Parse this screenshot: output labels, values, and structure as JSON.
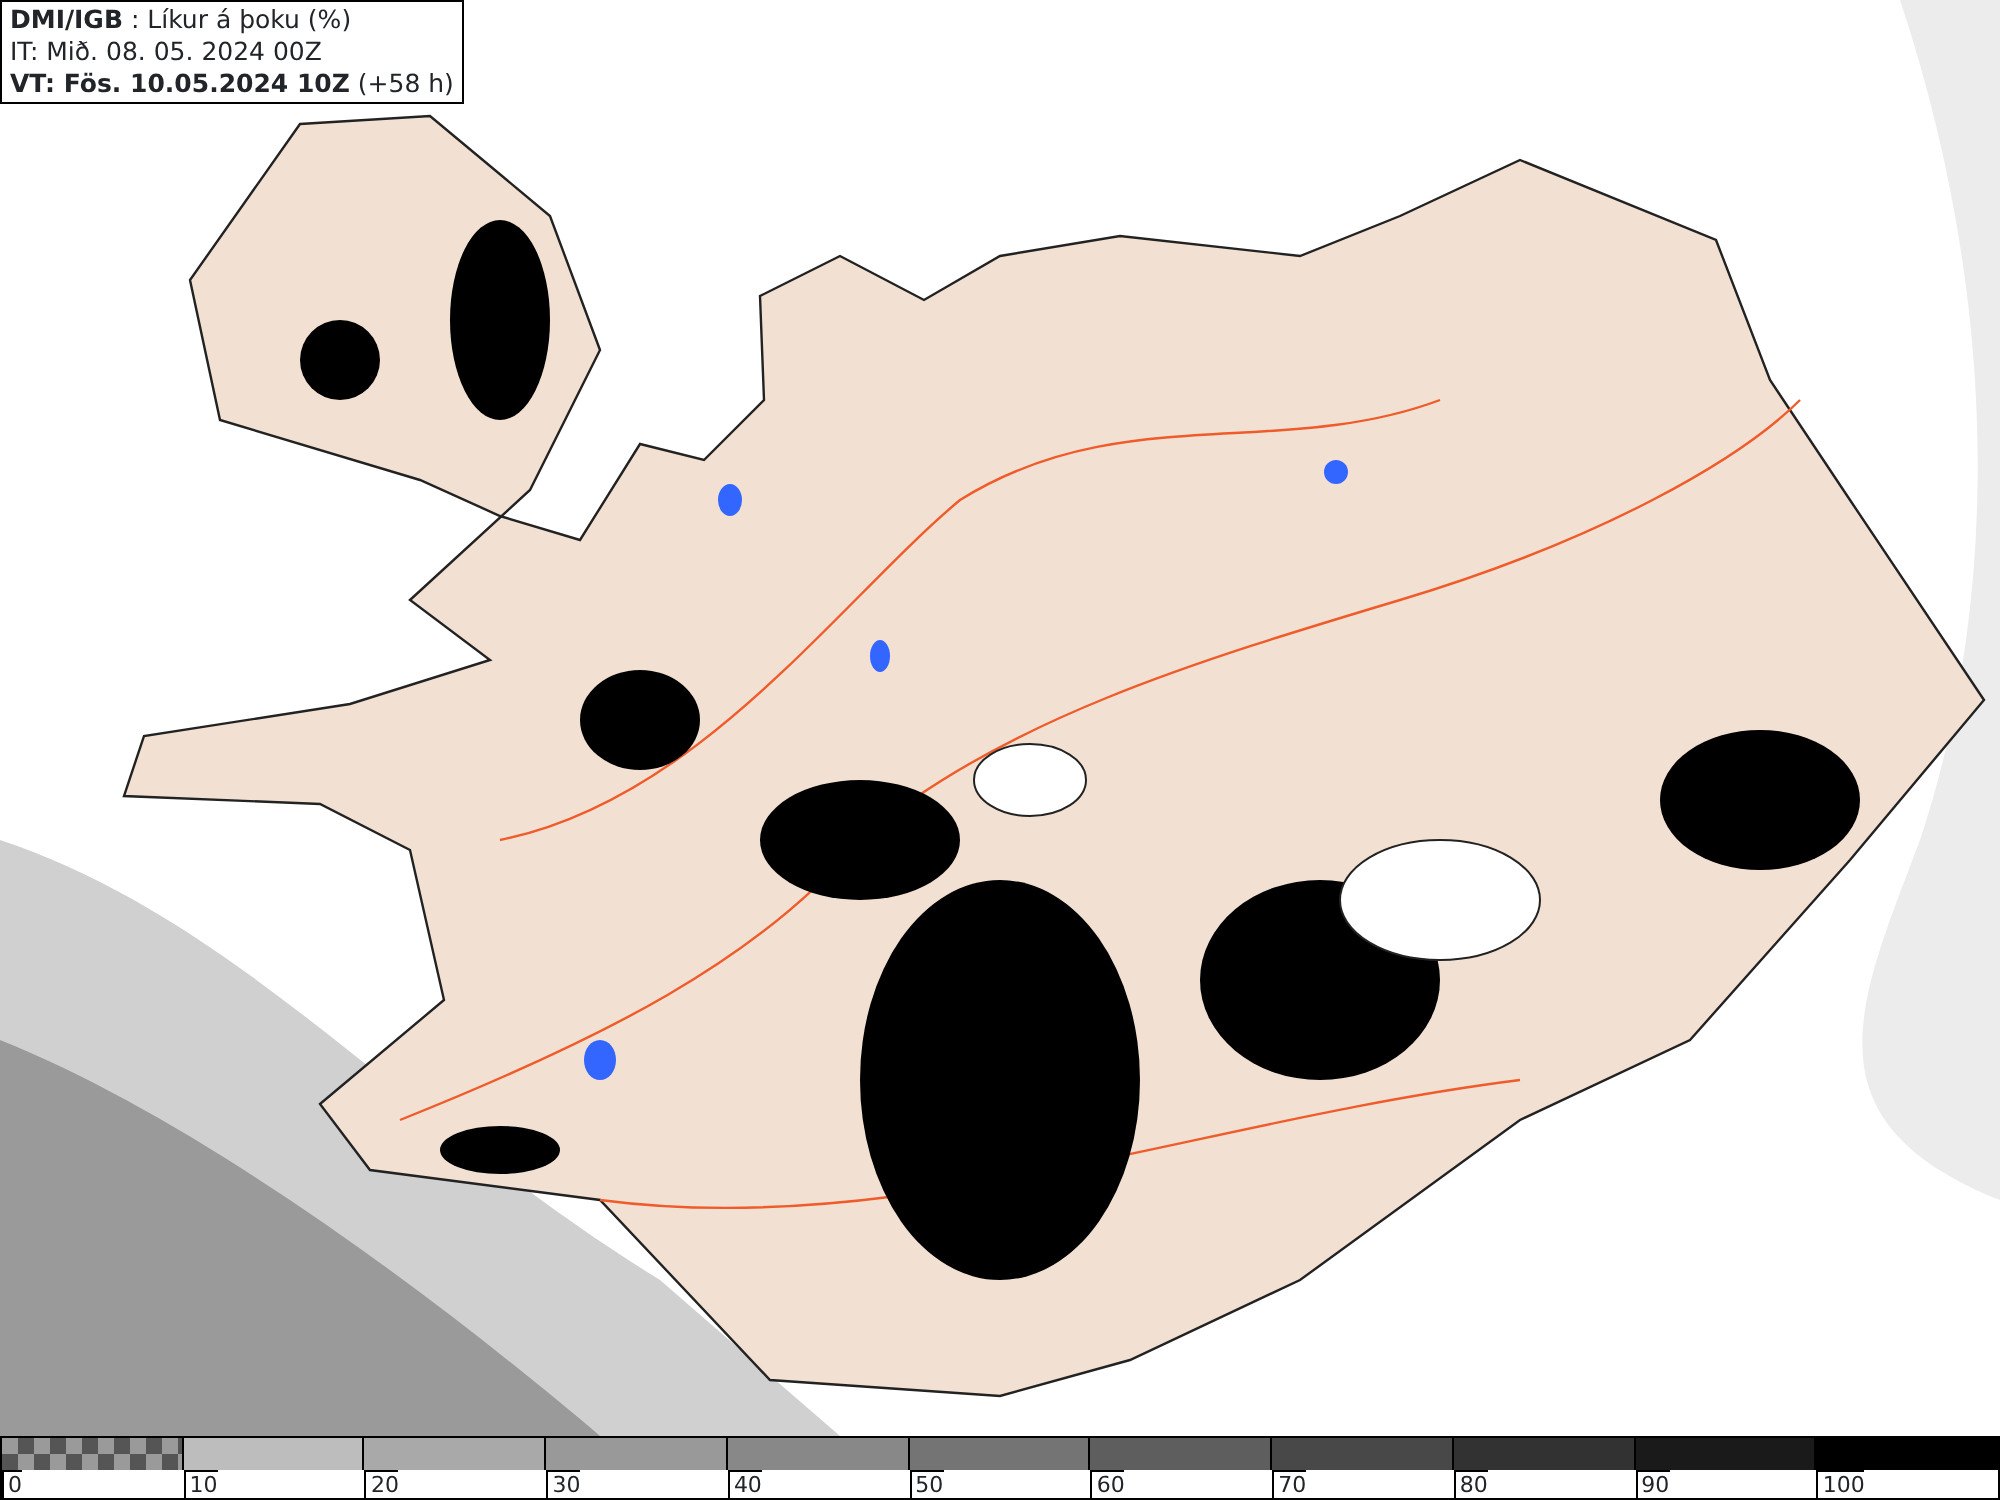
{
  "header": {
    "title": "**DMI/IGB** : Líkur á þoku (%)",
    "issue_time": "IT: Mið. 08. 05. 2024 00Z",
    "valid_time": "**VT: Fös. 10.05.2024 10Z** (+58 h)"
  },
  "legend": [
    {
      "kind": "checker",
      "label": "0"
    },
    {
      "kind": "solid",
      "label": "10",
      "color": "#bdbdbd"
    },
    {
      "kind": "solid",
      "label": "20",
      "color": "#a9a9a9"
    },
    {
      "kind": "solid",
      "label": "30",
      "color": "#999999"
    },
    {
      "kind": "solid",
      "label": "40",
      "color": "#888888"
    },
    {
      "kind": "solid",
      "label": "50",
      "color": "#747474"
    },
    {
      "kind": "solid",
      "label": "60",
      "color": "#5e5e5e"
    },
    {
      "kind": "solid",
      "label": "70",
      "color": "#484848"
    },
    {
      "kind": "solid",
      "label": "80",
      "color": "#323232"
    },
    {
      "kind": "solid",
      "label": "90",
      "color": "#1a1a1a"
    },
    {
      "kind": "solid",
      "label": "100",
      "color": "#000000"
    }
  ]
}
